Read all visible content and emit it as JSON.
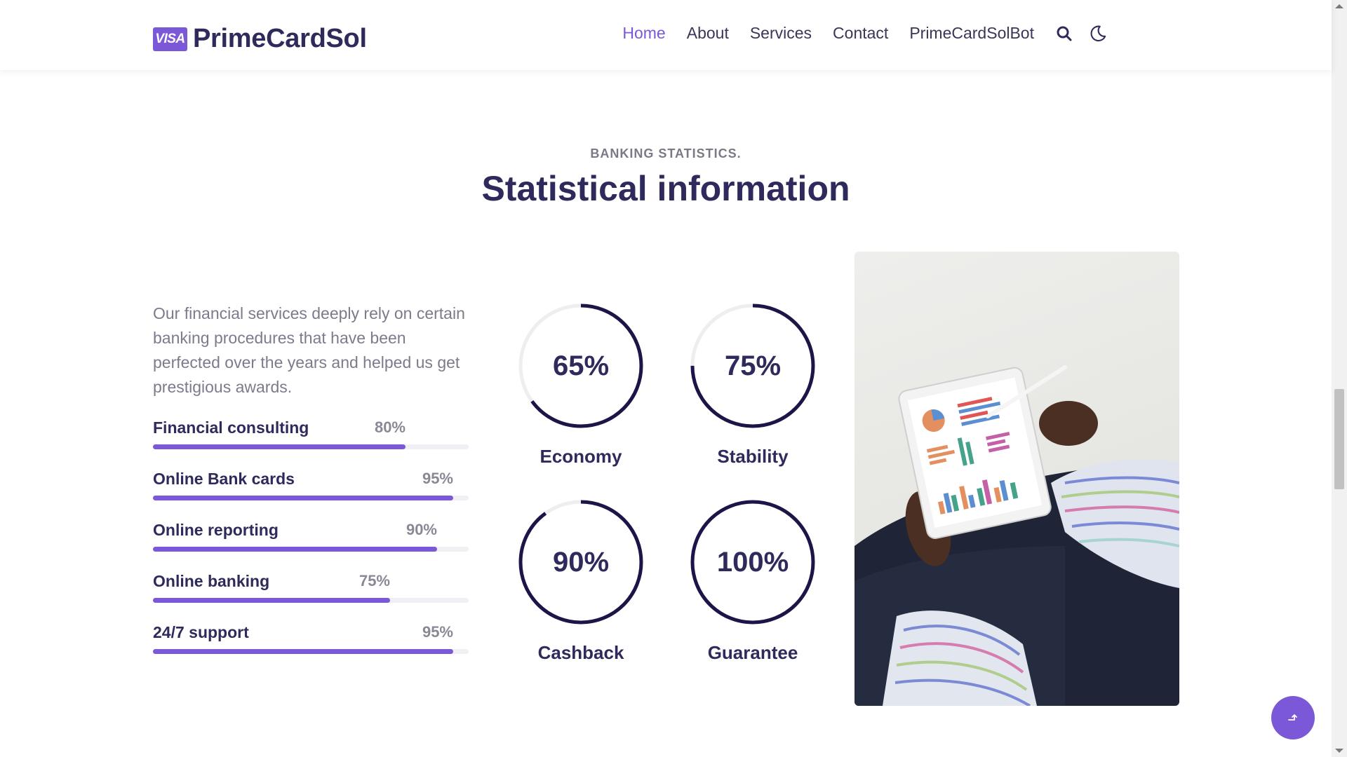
{
  "header": {
    "logo_badge": "VISA",
    "logo_text": "PrimeCardSol",
    "nav": [
      "Home",
      "About",
      "Services",
      "Contact",
      "PrimeCardSolBot"
    ],
    "active_nav": "Home",
    "icons": [
      "search-icon",
      "moon-icon"
    ]
  },
  "section": {
    "subtitle": "BANKING STATISTICS.",
    "title": "Statistical information",
    "intro": "Our financial services deeply rely on certain banking procedures that have been perfected over the years and helped us get prestigious awards."
  },
  "progress": [
    {
      "label": "Financial consulting",
      "value_text": "80%",
      "value": 0.8
    },
    {
      "label": "Online Bank cards",
      "value_text": "95%",
      "value": 0.95
    },
    {
      "label": "Online reporting",
      "value_text": "90%",
      "value": 0.9
    },
    {
      "label": "Online banking",
      "value_text": "75%",
      "value": 0.75
    },
    {
      "label": "24/7 support",
      "value_text": "95%",
      "value": 0.95
    }
  ],
  "circles": [
    {
      "label": "Economy",
      "value_text": "65%",
      "value": 0.65
    },
    {
      "label": "Stability",
      "value_text": "75%",
      "value": 0.75
    },
    {
      "label": "Cashback",
      "value_text": "90%",
      "value": 0.9
    },
    {
      "label": "Guarantee",
      "value_text": "100%",
      "value": 1.0
    }
  ],
  "colors": {
    "accent": "#7b58d8",
    "circle_stroke": "#1e1448",
    "heading": "#2e2a5c"
  },
  "back_to_top_icon": "arrow-up-icon"
}
